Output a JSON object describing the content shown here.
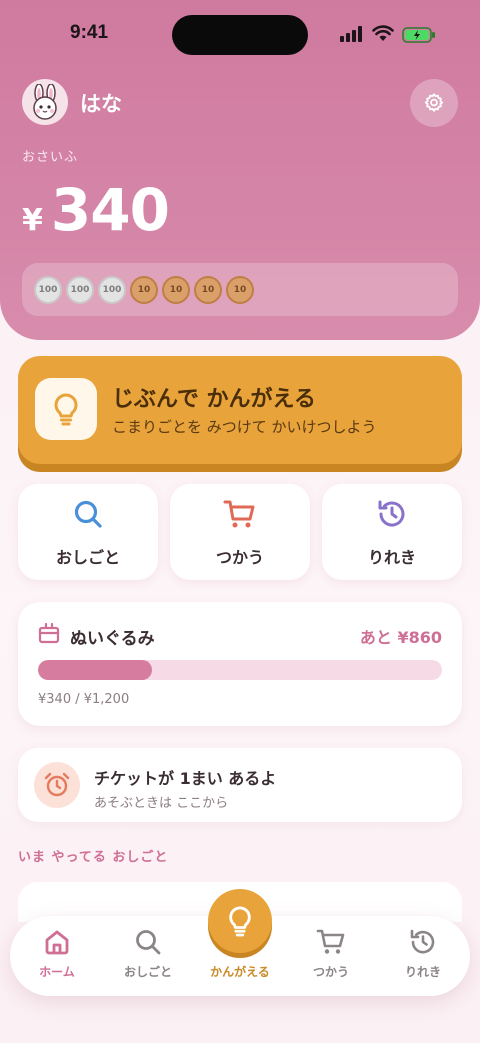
{
  "status_bar": {
    "time": "9:41"
  },
  "profile": {
    "name": "はな",
    "avatar_icon": "rabbit-icon"
  },
  "wallet": {
    "label": "おさいふ",
    "currency": "¥",
    "amount": "340",
    "coins": [
      {
        "value": "100",
        "kind": "silver"
      },
      {
        "value": "100",
        "kind": "silver"
      },
      {
        "value": "100",
        "kind": "silver"
      },
      {
        "value": "10",
        "kind": "bronze"
      },
      {
        "value": "10",
        "kind": "bronze"
      },
      {
        "value": "10",
        "kind": "bronze"
      },
      {
        "value": "10",
        "kind": "bronze"
      }
    ]
  },
  "think_card": {
    "title": "じぶんで かんがえる",
    "subtitle": "こまりごとを みつけて かいけつしよう",
    "icon": "lightbulb-icon"
  },
  "quick_actions": [
    {
      "label": "おしごと",
      "icon": "search-icon",
      "color": "#4a90d9"
    },
    {
      "label": "つかう",
      "icon": "cart-icon",
      "color": "#e06a55"
    },
    {
      "label": "りれき",
      "icon": "history-icon",
      "color": "#8a72c9"
    }
  ],
  "goal": {
    "title": "ぬいぐるみ",
    "remaining": "あと ¥860",
    "progress_text": "¥340 / ¥1,200",
    "progress_fraction": 0.283
  },
  "ticket": {
    "title": "チケットが 1まい あるよ",
    "subtitle": "あそぶときは ここから",
    "icon": "alarm-clock-icon"
  },
  "section": {
    "label": "いま やってる おしごと"
  },
  "tabbar": {
    "items": [
      {
        "label": "ホーム",
        "icon": "home-icon",
        "active": true
      },
      {
        "label": "おしごと",
        "icon": "search-icon"
      },
      {
        "label": "かんがえる",
        "icon": "lightbulb-icon",
        "center": true
      },
      {
        "label": "つかう",
        "icon": "cart-icon"
      },
      {
        "label": "りれき",
        "icon": "history-icon"
      }
    ]
  },
  "colors": {
    "header": "#cf7a9f",
    "accent_pink": "#cf6f95",
    "accent_orange": "#e8a33a"
  }
}
